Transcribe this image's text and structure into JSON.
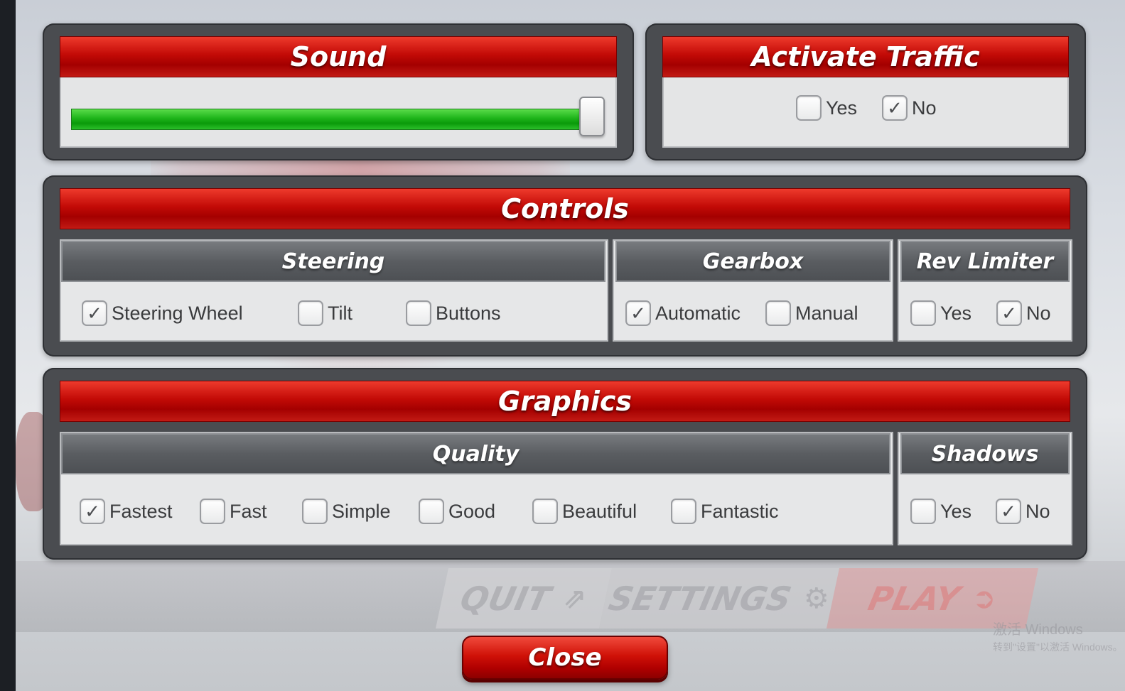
{
  "sound": {
    "title": "Sound",
    "volume_fraction": 1.0
  },
  "traffic": {
    "title": "Activate Traffic",
    "options": [
      {
        "label": "Yes",
        "checked": false
      },
      {
        "label": "No",
        "checked": true
      }
    ]
  },
  "controls": {
    "title": "Controls",
    "steering": {
      "title": "Steering",
      "options": [
        {
          "label": "Steering Wheel",
          "checked": true
        },
        {
          "label": "Tilt",
          "checked": false
        },
        {
          "label": "Buttons",
          "checked": false
        }
      ]
    },
    "gearbox": {
      "title": "Gearbox",
      "options": [
        {
          "label": "Automatic",
          "checked": true
        },
        {
          "label": "Manual",
          "checked": false
        }
      ]
    },
    "rev_limiter": {
      "title": "Rev Limiter",
      "options": [
        {
          "label": "Yes",
          "checked": false
        },
        {
          "label": "No",
          "checked": true
        }
      ]
    }
  },
  "graphics": {
    "title": "Graphics",
    "quality": {
      "title": "Quality",
      "options": [
        {
          "label": "Fastest",
          "checked": true
        },
        {
          "label": "Fast",
          "checked": false
        },
        {
          "label": "Simple",
          "checked": false
        },
        {
          "label": "Good",
          "checked": false
        },
        {
          "label": "Beautiful",
          "checked": false
        },
        {
          "label": "Fantastic",
          "checked": false
        }
      ]
    },
    "shadows": {
      "title": "Shadows",
      "options": [
        {
          "label": "Yes",
          "checked": false
        },
        {
          "label": "No",
          "checked": true
        }
      ]
    }
  },
  "background_menu": {
    "quit": "QUIT",
    "settings": "SETTINGS",
    "play": "PLAY"
  },
  "watermark": {
    "line1": "激活 Windows",
    "line2": "转到\"设置\"以激活 Windows。"
  },
  "close_label": "Close",
  "checkmark_glyph": "✓",
  "icons": {
    "quit": "share-arrow-icon",
    "settings": "gear-icon",
    "play": "play-circle-icon"
  },
  "colors": {
    "header_red": "#c20a06",
    "slider_green": "#1eb41a",
    "panel_frame": "#4a4c50"
  }
}
